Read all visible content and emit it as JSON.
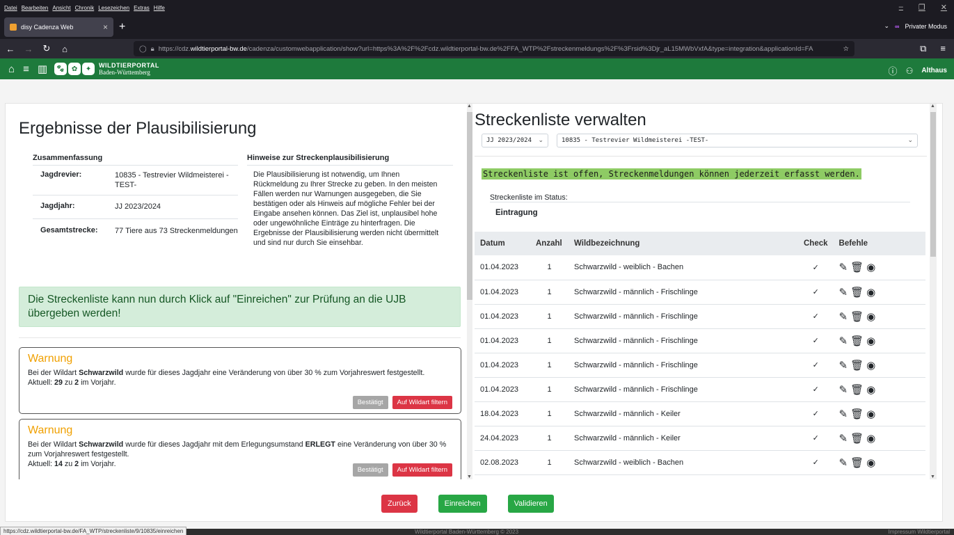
{
  "browser": {
    "menu": [
      "Datei",
      "Bearbeiten",
      "Ansicht",
      "Chronik",
      "Lesezeichen",
      "Extras",
      "Hilfe"
    ],
    "tab_title": "disy Cadenza Web",
    "private_label": "Privater Modus",
    "url_prefix": "https://cdz.",
    "url_domain": "wildtierportal-bw.de",
    "url_rest": "/cadenza/customwebapplication/show?url=https%3A%2F%2Fcdz.wildtierportal-bw.de%2FFA_WTP%2Fstreckenmeldungs%2F%3Frsid%3Djr_aL15MWbVxfA&type=integration&applicationId=FA",
    "status_url": "https://cdz.wildtierportal-bw.de/FA_WTP/streckenliste/9/10835/einreichen"
  },
  "app": {
    "logo_line1": "WILDTIERPORTAL",
    "logo_line2": "Baden-Württemberg",
    "user": "Althaus"
  },
  "left": {
    "title": "Ergebnisse der Plausibilisierung",
    "summary_head": "Zusammenfassung",
    "summary": [
      {
        "key": "Jagdrevier:",
        "value": "10835 - Testrevier Wildmeisterei -TEST-"
      },
      {
        "key": "Jagdjahr:",
        "value": "JJ 2023/2024"
      },
      {
        "key": "Gesamtstrecke:",
        "value": "77 Tiere aus 73 Streckenmeldungen"
      }
    ],
    "hint_head": "Hinweise zur Streckenplausibilisierung",
    "hint_text": "Die Plausibilisierung ist notwendig, um Ihnen Rückmeldung zu Ihrer Strecke zu geben. In den meisten Fällen werden nur Warnungen ausgegeben, die Sie bestätigen oder als Hinweis auf mögliche Fehler bei der Eingabe ansehen können. Das Ziel ist, unplausibel hohe oder ungewöhnliche Einträge zu hinterfragen. Die Ergebnisse der Plausibilisierung werden nicht übermittelt und sind nur durch Sie einsehbar.",
    "success_msg": "Die Streckenliste kann nun durch Klick auf \"Einreichen\" zur Prüfung an die UJB übergeben werden!",
    "warnings": [
      {
        "title": "Warnung",
        "t1": "Bei der Wildart ",
        "b1": "Schwarzwild",
        "t2": " wurde für dieses Jagdjahr eine Veränderung von über 30 % zum Vorjahreswert festgestellt.",
        "b2": "",
        "t3": "",
        "cur_pre": "Aktuell: ",
        "cur_val": "29",
        "cur_mid": " zu ",
        "cur_prev": "2",
        "cur_post": " im Vorjahr.",
        "btn_confirm": "Bestätigt",
        "btn_filter": "Auf Wildart filtern"
      },
      {
        "title": "Warnung",
        "t1": "Bei der Wildart ",
        "b1": "Schwarzwild",
        "t2": " wurde für dieses Jagdjahr mit dem Erlegungsumstand ",
        "b2": "ERLEGT",
        "t3": " eine Veränderung von über 30 % zum Vorjahreswert festgestellt.",
        "cur_pre": "Aktuell: ",
        "cur_val": "14",
        "cur_mid": " zu ",
        "cur_prev": "2",
        "cur_post": " im Vorjahr.",
        "btn_confirm": "Bestätigt",
        "btn_filter": "Auf Wildart filtern"
      }
    ]
  },
  "right": {
    "title": "Streckenliste verwalten",
    "year_select": "JJ 2023/2024",
    "revier_select": "10835 - Testrevier Wildmeisterei -TEST-",
    "status_msg": "Streckenliste ist offen, Streckenmeldungen können jederzeit erfasst werden.",
    "status_label": "Streckenliste im Status:",
    "status_value": "Eintragung",
    "columns": [
      "Datum",
      "Anzahl",
      "Wildbezeichnung",
      "Check",
      "Befehle"
    ],
    "rows": [
      {
        "date": "01.04.2023",
        "count": "1",
        "name": "Schwarzwild - weiblich - Bachen",
        "check": "✓"
      },
      {
        "date": "01.04.2023",
        "count": "1",
        "name": "Schwarzwild - männlich - Frischlinge",
        "check": "✓"
      },
      {
        "date": "01.04.2023",
        "count": "1",
        "name": "Schwarzwild - männlich - Frischlinge",
        "check": "✓"
      },
      {
        "date": "01.04.2023",
        "count": "1",
        "name": "Schwarzwild - männlich - Frischlinge",
        "check": "✓"
      },
      {
        "date": "01.04.2023",
        "count": "1",
        "name": "Schwarzwild - männlich - Frischlinge",
        "check": "✓"
      },
      {
        "date": "01.04.2023",
        "count": "1",
        "name": "Schwarzwild - männlich - Frischlinge",
        "check": "✓"
      },
      {
        "date": "18.04.2023",
        "count": "1",
        "name": "Schwarzwild - männlich - Keiler",
        "check": "✓"
      },
      {
        "date": "24.04.2023",
        "count": "1",
        "name": "Schwarzwild - männlich - Keiler",
        "check": "✓"
      },
      {
        "date": "02.08.2023",
        "count": "1",
        "name": "Schwarzwild - weiblich - Bachen",
        "check": "✓"
      }
    ]
  },
  "actions": {
    "back": "Zurück",
    "submit": "Einreichen",
    "validate": "Validieren"
  },
  "footer": {
    "center": "Wildtierportal Baden-Württemberg © 2023",
    "right": "Impressum Wildtierportal"
  },
  "colors": {
    "header_green": "#1e7a3c",
    "success_bg": "#d4edda",
    "status_highlight": "#8ecb64",
    "warning_title": "#f0a000",
    "danger": "#dc3545",
    "success": "#28a745"
  }
}
